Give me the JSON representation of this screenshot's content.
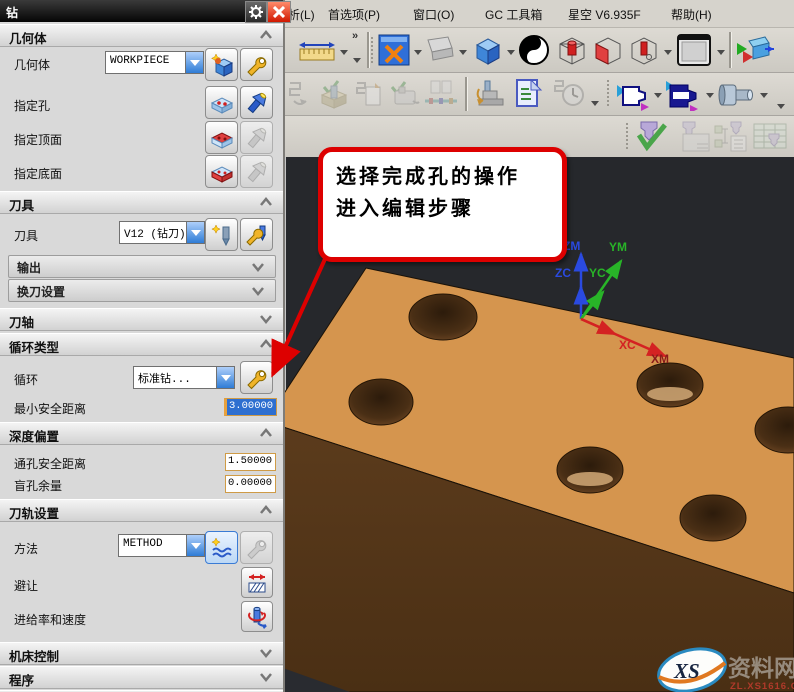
{
  "menu": {
    "items": [
      "析(L)",
      "首选项(P)",
      "窗口(O)",
      "GC 工具箱",
      "星空 V6.935F",
      "帮助(H)"
    ]
  },
  "dialog": {
    "title": "钻",
    "geometry": {
      "header": "几何体",
      "label": "几何体",
      "value": "WORKPIECE",
      "hole_label": "指定孔",
      "top_label": "指定顶面",
      "bottom_label": "指定底面"
    },
    "tool": {
      "header": "刀具",
      "label": "刀具",
      "value": "V12 (钻刀)",
      "output_label": "输出",
      "change_label": "换刀设置"
    },
    "axis": {
      "header": "刀轴"
    },
    "cycle": {
      "header": "循环类型",
      "label": "循环",
      "value": "标准钻...",
      "min_clearance_label": "最小安全距离",
      "min_clearance_value": "3.00000"
    },
    "depth": {
      "header": "深度偏置",
      "through_label": "通孔安全距离",
      "through_value": "1.50000",
      "blind_label": "盲孔余量",
      "blind_value": "0.00000"
    },
    "path": {
      "header": "刀轨设置",
      "method_label": "方法",
      "method_value": "METHOD",
      "avoid_label": "避让",
      "feeds_label": "进给率和速度"
    },
    "machine": {
      "header": "机床控制"
    },
    "program": {
      "header": "程序"
    }
  },
  "toolbar": {
    "overflow_glyph": "»"
  },
  "callout": {
    "line1": "选择完成孔的操作",
    "line2": "进入编辑步骤"
  },
  "viewport": {
    "triad": {
      "zm": "ZM",
      "zc": "ZC",
      "ym": "YM",
      "yc": "YC",
      "xc": "XC",
      "xm": "XM"
    }
  },
  "watermark": {
    "logo": "XS",
    "name": "资料网",
    "url": "ZL.XS1616.COM"
  },
  "colors": {
    "callout_red": "#dd0000",
    "top_face": "#d5954e",
    "front_face": "#4f3317",
    "viewport_bg": "#26282c",
    "select_blue": "#2e6fd0"
  }
}
